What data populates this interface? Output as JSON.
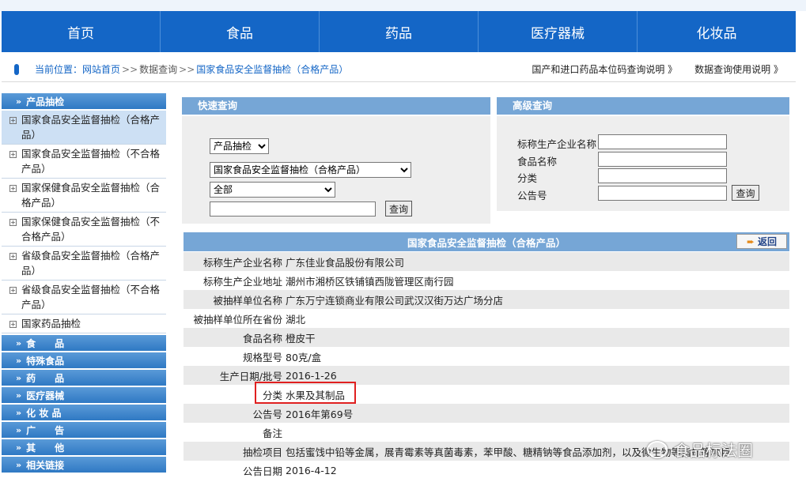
{
  "nav": [
    "首页",
    "食品",
    "药品",
    "医疗器械",
    "化妆品"
  ],
  "breadcrumb": {
    "label": "当前位置：",
    "home": "网站首页",
    "sep": ">>",
    "level1": "数据查询",
    "current": "国家食品安全监督抽检（合格产品）",
    "right_links": [
      "国产和进口药品本位码查询说明 》",
      "数据查询使用说明 》"
    ]
  },
  "sidebar": {
    "product_head": "产品抽检",
    "items": [
      "国家食品安全监督抽检（合格产品）",
      "国家食品安全监督抽检（不合格产品）",
      "国家保健食品安全监督抽检（合格产品）",
      "国家保健食品安全监督抽检（不合格产品）",
      "省级食品安全监督抽检（合格产品）",
      "省级食品安全监督抽检（不合格产品）",
      "国家药品抽检"
    ],
    "heads": [
      "食　　品",
      "特殊食品",
      "药　　品",
      "医疗器械",
      "化 妆 品",
      "广　　告",
      "其　　他",
      "相关链接"
    ]
  },
  "quick": {
    "title": "快速查询",
    "select1": "产品抽检",
    "select2": "国家食品安全监督抽检（合格产品）",
    "select3": "全部",
    "input_value": "",
    "button": "查询"
  },
  "advanced": {
    "title": "高级查询",
    "labels": [
      "标称生产企业名称",
      "食品名称",
      "分类",
      "公告号"
    ],
    "button": "查询"
  },
  "detail": {
    "title": "国家食品安全监督抽检（合格产品）",
    "back": "返回",
    "rows": [
      {
        "k": "标称生产企业名称",
        "v": "广东佳业食品股份有限公司"
      },
      {
        "k": "标称生产企业地址",
        "v": "潮州市湘桥区铁铺镇西陇管理区南行园"
      },
      {
        "k": "被抽样单位名称",
        "v": "广东万宁连锁商业有限公司武汉汉街万达广场分店"
      },
      {
        "k": "被抽样单位所在省份",
        "v": "湖北"
      },
      {
        "k": "食品名称",
        "v": "橙皮干"
      },
      {
        "k": "规格型号",
        "v": "80克/盒"
      },
      {
        "k": "生产日期/批号",
        "v": "2016-1-26"
      },
      {
        "k": "分类",
        "v": "水果及其制品"
      },
      {
        "k": "公告号",
        "v": "2016年第69号"
      },
      {
        "k": "备注",
        "v": ""
      },
      {
        "k": "抽检项目",
        "v": "包括蜜饯中铅等金属，展青霉素等真菌毒素，苯甲酸、糖精钠等食品添加剂，以及微生物等指标等项目"
      },
      {
        "k": "公告日期",
        "v": "2016-4-12"
      }
    ]
  },
  "watermark": "食品标法圈"
}
